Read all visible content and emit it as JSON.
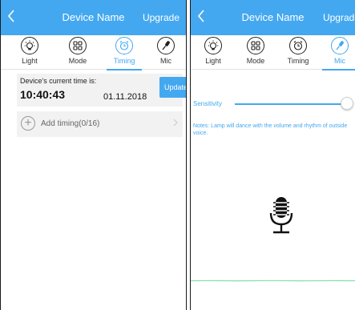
{
  "colors": {
    "accent": "#44a8f0",
    "wave": "#7ee0b0"
  },
  "screen_timing": {
    "nav": {
      "back_icon": "chevron-left-icon",
      "title": "Device Name",
      "right": "Upgrade"
    },
    "tabs": [
      {
        "label": "Light",
        "icon": "bulb-icon",
        "active": false
      },
      {
        "label": "Mode",
        "icon": "grid-icon",
        "active": false
      },
      {
        "label": "Timing",
        "icon": "alarm-clock-icon",
        "active": true
      },
      {
        "label": "Mic",
        "icon": "microphone-icon",
        "active": false
      }
    ],
    "time_card": {
      "caption": "Device's current time is:",
      "time": "10:40:43",
      "date": "01.11.2018",
      "button": "Update"
    },
    "add_timing": {
      "label": "Add timing(0/16)",
      "icon": "plus-circle-icon"
    }
  },
  "screen_mic": {
    "nav": {
      "back_icon": "chevron-left-icon",
      "title": "Device Name",
      "right": "Upgrade"
    },
    "tabs": [
      {
        "label": "Light",
        "icon": "bulb-icon",
        "active": false
      },
      {
        "label": "Mode",
        "icon": "grid-icon",
        "active": false
      },
      {
        "label": "Timing",
        "icon": "alarm-clock-icon",
        "active": false
      },
      {
        "label": "Mic",
        "icon": "microphone-icon",
        "active": true
      }
    ],
    "sensitivity": {
      "label": "Sensitivity",
      "value_fraction": 0.97
    },
    "notes": "Notes: Lamp will dance with the volume and rhythm of outside voice.",
    "mic_icon": "microphone-icon"
  }
}
